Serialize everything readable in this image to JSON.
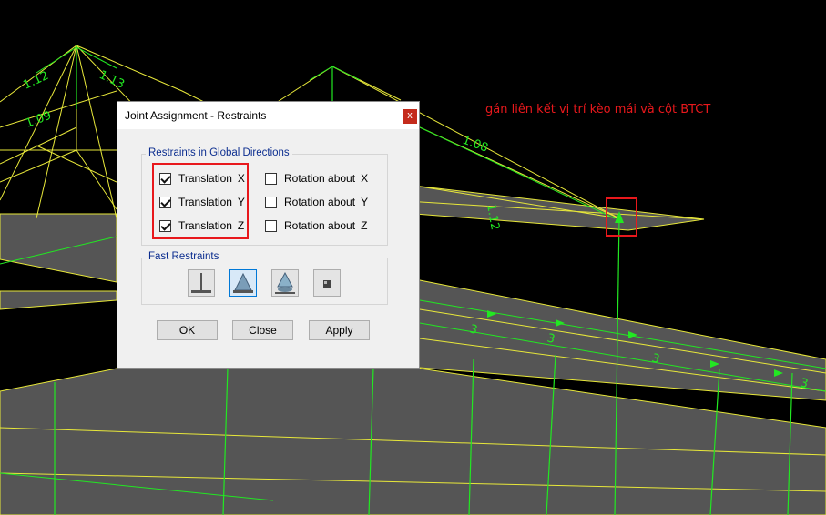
{
  "viewport": {
    "labels": [
      "1.12",
      "1.13",
      "1.08",
      "1.09",
      "1.12",
      "3",
      "3",
      "3",
      "3"
    ],
    "colors": {
      "background": "#000000",
      "frame_lines": "#e8e83a",
      "columns": "#22e822",
      "slab": "#555555"
    }
  },
  "annotation": {
    "text": "gán liên kết vị trí kèo mái và cột BTCT",
    "color": "#e8181c"
  },
  "dialog": {
    "title": "Joint Assignment - Restraints",
    "close_glyph": "x",
    "global_group": {
      "label": "Restraints in Global Directions",
      "translation_x": {
        "label": "Translation",
        "axis": "X",
        "checked": true
      },
      "translation_y": {
        "label": "Translation",
        "axis": "Y",
        "checked": true
      },
      "translation_z": {
        "label": "Translation",
        "axis": "Z",
        "checked": true
      },
      "rotation_x": {
        "label": "Rotation about",
        "axis": "X",
        "checked": false
      },
      "rotation_y": {
        "label": "Rotation about",
        "axis": "Y",
        "checked": false
      },
      "rotation_z": {
        "label": "Rotation about",
        "axis": "Z",
        "checked": false
      }
    },
    "fast_group": {
      "label": "Fast Restraints",
      "buttons": [
        {
          "name": "fixed-support-icon",
          "selected": false
        },
        {
          "name": "pinned-support-icon",
          "selected": true
        },
        {
          "name": "roller-support-icon",
          "selected": false
        },
        {
          "name": "free-joint-icon",
          "selected": false
        }
      ]
    },
    "buttons": {
      "ok": "OK",
      "close": "Close",
      "apply": "Apply"
    }
  }
}
